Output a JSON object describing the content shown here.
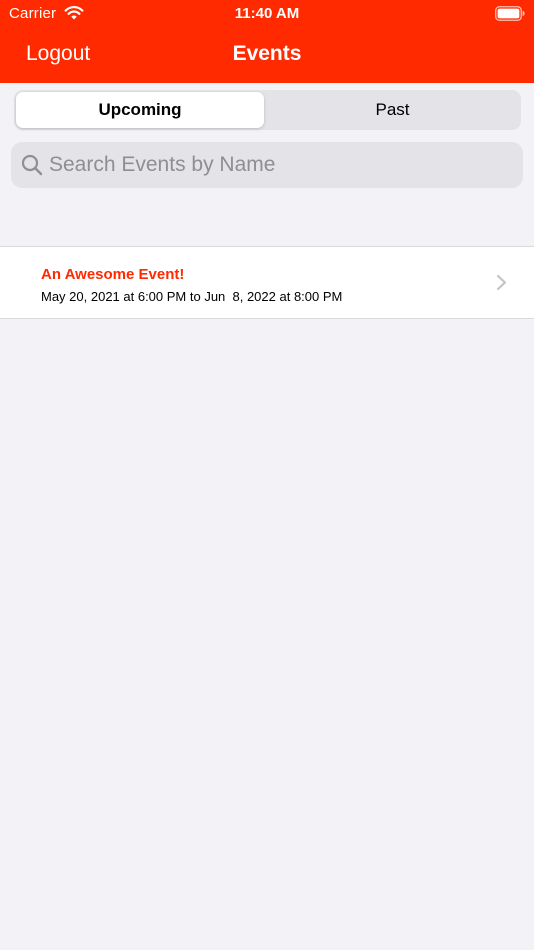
{
  "status_bar": {
    "carrier": "Carrier",
    "time": "11:40 AM"
  },
  "nav": {
    "left_button": "Logout",
    "title": "Events"
  },
  "segments": {
    "items": [
      "Upcoming",
      "Past"
    ],
    "selected": "Upcoming"
  },
  "search": {
    "placeholder": "Search Events by Name",
    "value": ""
  },
  "events": [
    {
      "name": "An Awesome Event!",
      "dates": "May 20, 2021 at 6:00 PM to Jun  8, 2022 at 8:00 PM"
    }
  ],
  "colors": {
    "accent": "#FF2A00",
    "background": "#F2F2F7",
    "control_fill": "#E3E3E8",
    "placeholder": "#8E8E93"
  },
  "icons": {
    "wifi": "wifi-icon",
    "battery": "battery-icon",
    "search": "magnifying-glass-icon",
    "disclosure": "chevron-right-icon"
  }
}
